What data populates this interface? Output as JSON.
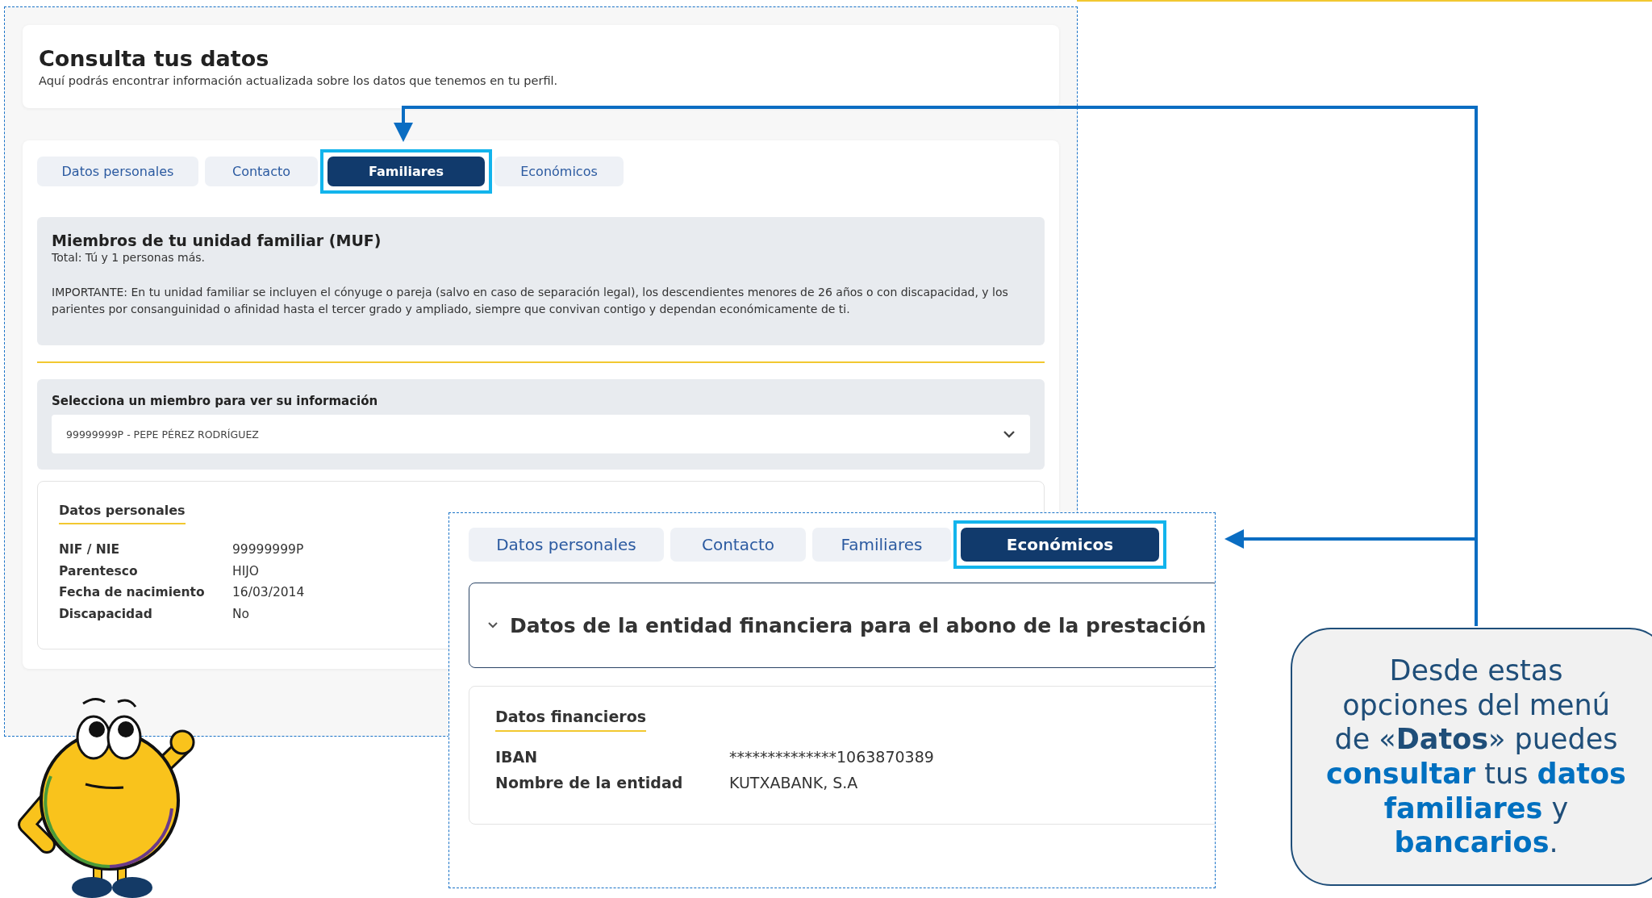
{
  "panel_familiares": {
    "header": {
      "title": "Consulta tus datos",
      "subtitle": "Aquí podrás encontrar información actualizada sobre los datos que tenemos en tu perfil."
    },
    "tabs": [
      {
        "label": "Datos personales",
        "selected": false
      },
      {
        "label": "Contacto",
        "selected": false
      },
      {
        "label": "Familiares",
        "selected": true
      },
      {
        "label": "Económicos",
        "selected": false
      }
    ],
    "muf": {
      "title": "Miembros de tu unidad familiar (MUF)",
      "total": "Total: Tú y 1 personas más.",
      "note": "IMPORTANTE: En tu unidad familiar se incluyen el cónyuge o pareja (salvo en caso de separación legal), los descendientes menores de 26 años o con discapacidad, y los parientes por consanguinidad o afinidad hasta el tercer grado y ampliado, siempre que convivan contigo y dependan económicamente de ti."
    },
    "member_select": {
      "label": "Selecciona un miembro para ver su información",
      "value": "99999999P - PEPE PÉREZ RODRÍGUEZ"
    },
    "personal": {
      "title": "Datos personales",
      "rows": [
        {
          "label": "NIF / NIE",
          "value": "99999999P"
        },
        {
          "label": "Parentesco",
          "value": "HIJO"
        },
        {
          "label": "Fecha de nacimiento",
          "value": "16/03/2014"
        },
        {
          "label": "Discapacidad",
          "value": "No"
        }
      ]
    }
  },
  "panel_economicos": {
    "tabs": [
      {
        "label": "Datos personales",
        "selected": false
      },
      {
        "label": "Contacto",
        "selected": false
      },
      {
        "label": "Familiares",
        "selected": false
      },
      {
        "label": "Económicos",
        "selected": true
      }
    ],
    "accordion": {
      "title": "Datos de la entidad financiera para el abono de la prestación",
      "expanded": true
    },
    "financial": {
      "title": "Datos financieros",
      "rows": [
        {
          "label": "IBAN",
          "value": "**************1063870389"
        },
        {
          "label": "Nombre de la entidad",
          "value": "KUTXABANK, S.A"
        }
      ]
    }
  },
  "callout": {
    "text": "Desde estas opciones del menú de «**Datos**» puedes **consultar** tus **datos familiares** y **bancarios**."
  }
}
